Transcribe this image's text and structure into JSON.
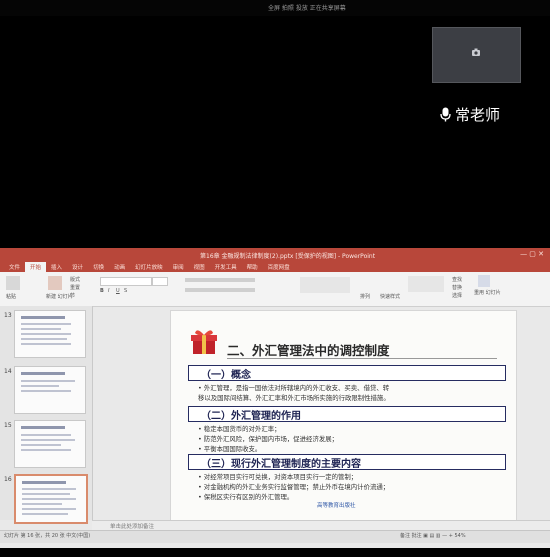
{
  "top_toolbar": {
    "text": "全屏 拍照 投放 正在共享屏幕",
    "icons": [
      "fullscreen-icon",
      "snapshot-icon",
      "share-icon"
    ]
  },
  "camera": {
    "icon": "camera-icon"
  },
  "teacher": {
    "name": "常老师",
    "icon": "microphone-icon"
  },
  "ppt": {
    "window_title": "第16章 金融规制法律制度(2).pptx [受保护的视图] - PowerPoint",
    "tabs": [
      "文件",
      "开始",
      "插入",
      "设计",
      "切换",
      "动画",
      "幻灯片放映",
      "审阅",
      "视图",
      "开发工具",
      "帮助",
      "百度网盘"
    ],
    "active_tab": "开始",
    "ribbon": {
      "paste": "粘贴",
      "new_slide": "新建\n幻灯片",
      "layout": "版式",
      "reset": "重置",
      "section": "节",
      "font_box": "",
      "size_box": "",
      "bold": "B",
      "italic": "I",
      "underline": "U",
      "strike": "S",
      "arrange": "排列",
      "quick_styles": "快速样式",
      "find": "查找",
      "replace": "替换",
      "select": "选择",
      "reuse": "重用\n幻灯片"
    },
    "slides": [
      {
        "num": "13"
      },
      {
        "num": "14"
      },
      {
        "num": "15"
      },
      {
        "num": "16"
      }
    ],
    "slide": {
      "title": "二、外汇管理法中的调控制度",
      "sections": [
        {
          "heading": "（一）概念",
          "lines": [
            "• 外汇管理，是指一国依法对所辖境内的外汇收支、买卖、借贷、转",
            "  移以及国际间结算、外汇汇率和外汇市场所实施的行政限制性措施。"
          ]
        },
        {
          "heading": "（二）外汇管理的作用",
          "lines": [
            "• 稳定本国货币的对外汇率；",
            "• 防范外汇风险，保护国内市场，促进经济发展；",
            "• 平衡本国国际收支。"
          ]
        },
        {
          "heading": "（三）现行外汇管理制度的主要内容",
          "lines": [
            "• 对经常项目实行可兑换，对资本项目实行一定的管制；",
            "• 对金融机构的外汇业务实行监督管理；禁止外币在境内计价流通；",
            "• 保税区实行有区别的外汇管理。"
          ]
        }
      ],
      "footer": "高等教育出版社"
    },
    "notes_placeholder": "单击此处添加备注",
    "status_left": "幻灯片 第 16 张，共 20 张    中文(中国)",
    "status_right": "备注  批注   ▣  ▤  ▥   —  +  54%"
  }
}
